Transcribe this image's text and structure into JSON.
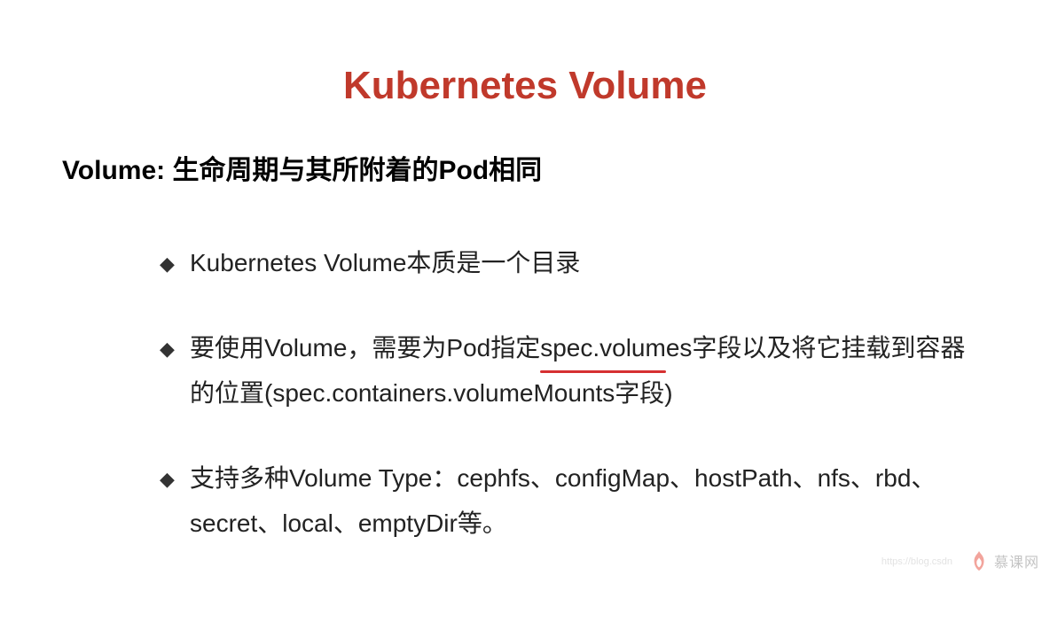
{
  "title": "Kubernetes Volume",
  "subtitle": "Volume: 生命周期与其所附着的Pod相同",
  "bullets": [
    {
      "prefix": "",
      "plain": "Kubernetes Volume本质是一个目录",
      "hasUnderline": false
    },
    {
      "pre": "要使用Volume，需要为Pod指定",
      "underlined": "spec.volum",
      "post": "es字段以及将它挂载到容器的位置(spec.containers.volumeMounts字段)",
      "hasUnderline": true
    },
    {
      "prefix": "",
      "plain": "支持多种Volume Type：cephfs、configMap、hostPath、nfs、rbd、secret、local、emptyDir等。",
      "hasUnderline": false
    }
  ],
  "watermark": {
    "url": "https://blog.csdn",
    "brand": "慕课网"
  },
  "colors": {
    "titleColor": "#c0392b",
    "underlineColor": "#d63031",
    "flameColor": "#e74c3c"
  }
}
